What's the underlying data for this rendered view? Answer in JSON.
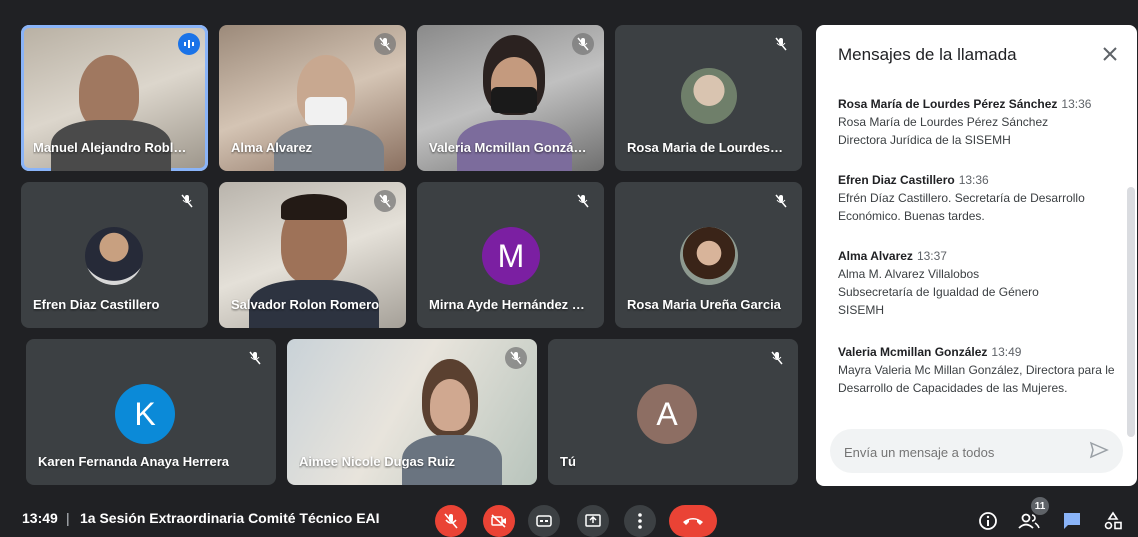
{
  "participants": [
    {
      "name": "Manuel Alejandro Robles...",
      "speaking": true
    },
    {
      "name": "Alma Alvarez"
    },
    {
      "name": "Valeria Mcmillan González"
    },
    {
      "name": "Rosa Maria de Lourdes Pé..."
    },
    {
      "name": "Efren Diaz Castillero"
    },
    {
      "name": "Salvador Rolon Romero"
    },
    {
      "name": "Mirna Ayde Hernández M...",
      "initial": "M",
      "color": "#7b1fa2"
    },
    {
      "name": "Rosa Maria Ureña Garcia"
    },
    {
      "name": "Karen Fernanda Anaya Herrera",
      "initial": "K",
      "color": "#0b8ad8"
    },
    {
      "name": "Aimee Nicole Dugas Ruiz"
    },
    {
      "name": "Tú",
      "initial": "A",
      "color": "#8d6e63"
    }
  ],
  "chat": {
    "title": "Mensajes de la llamada",
    "messages": [
      {
        "sender": "Rosa María de Lourdes Pérez Sánchez",
        "time": "13:36",
        "lines": [
          "Rosa María de Lourdes Pérez Sánchez",
          "Directora Jurídica de la SISEMH"
        ]
      },
      {
        "sender": "Efren Diaz Castillero",
        "time": "13:36",
        "lines": [
          "Efrén Díaz Castillero. Secretaría de Desarrollo",
          "Económico. Buenas tardes."
        ]
      },
      {
        "sender": "Alma Alvarez",
        "time": "13:37",
        "lines": [
          "Alma M. Alvarez Villalobos",
          "Subsecretaría de Igualdad de Género",
          "SISEMH"
        ]
      },
      {
        "sender": "Valeria Mcmillan González",
        "time": "13:49",
        "lines": [
          "Mayra Valeria Mc Millan González, Directora para le",
          "Desarrollo de Capacidades de las Mujeres."
        ]
      }
    ],
    "input_placeholder": "Envía un mensaje a todos"
  },
  "bottombar": {
    "clock": "13:49",
    "separator": "|",
    "meeting_title": "1a Sesión Extraordinaria Comité Técnico EAI",
    "participant_count": "11"
  },
  "colors": {
    "accent": "#8ab4f8",
    "danger": "#ea4335",
    "panel": "#3c4043",
    "background": "#202124"
  }
}
